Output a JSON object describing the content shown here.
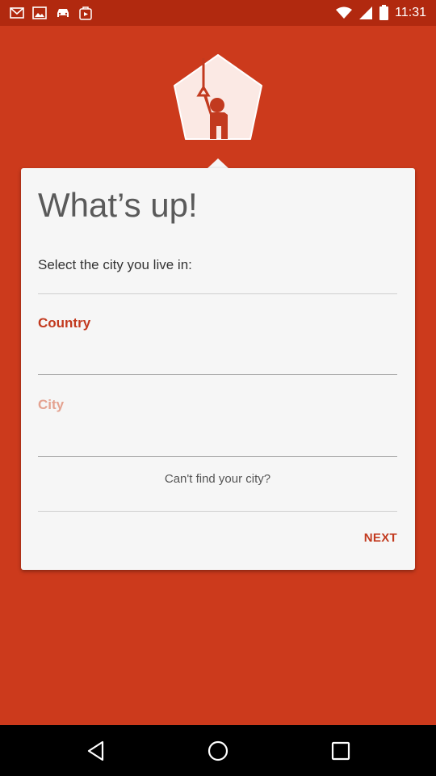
{
  "status_bar": {
    "time": "11:31",
    "left_icons": [
      "mail-icon",
      "image-icon",
      "car-icon",
      "play-store-icon"
    ],
    "right_icons": [
      "wifi-icon",
      "signal-icon",
      "battery-icon"
    ]
  },
  "card": {
    "title": "What’s up!",
    "subtitle": "Select the city you live in:",
    "country": {
      "label": "Country",
      "value": ""
    },
    "city": {
      "label": "City",
      "value": ""
    },
    "cant_find_link": "Can't find your city?",
    "next_button": "NEXT"
  },
  "nav_bar": {
    "buttons": [
      "back-icon",
      "home-icon",
      "recents-icon"
    ]
  },
  "colors": {
    "background": "#cc3a1c",
    "status_bar": "#b1290f",
    "accent": "#c23a1f",
    "card": "#f6f6f6"
  }
}
